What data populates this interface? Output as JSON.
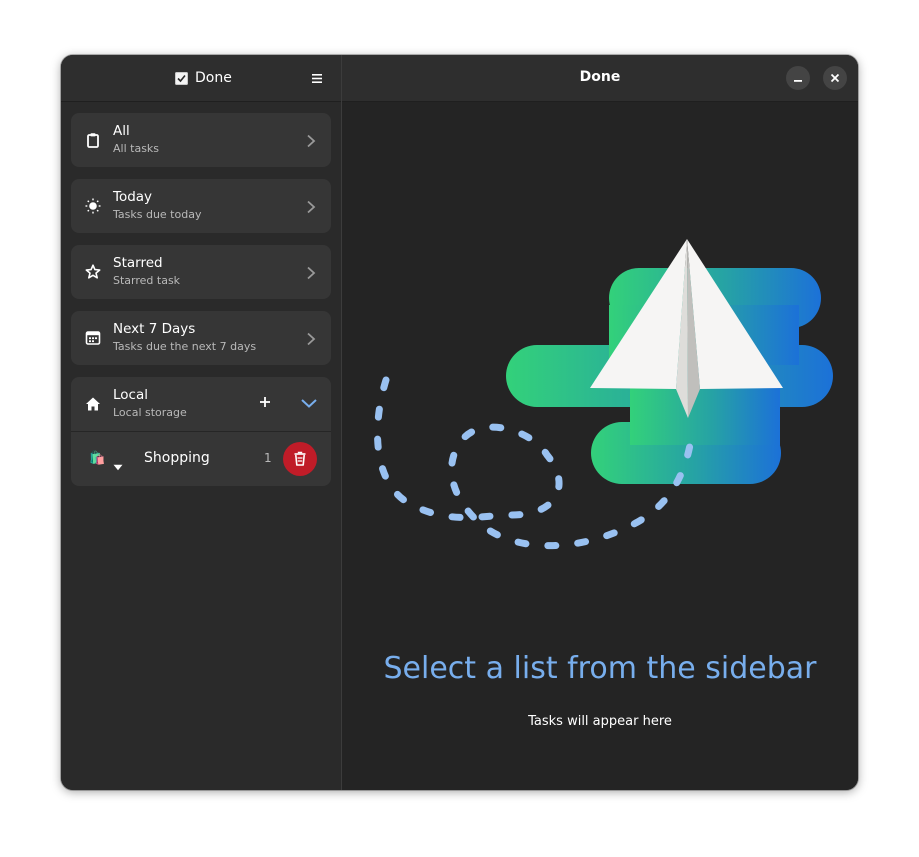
{
  "sidebar": {
    "title": "Done",
    "title_icon": "checkbox-icon",
    "menu_icon": "hamburger-menu-icon",
    "smart_lists": [
      {
        "title": "All",
        "subtitle": "All tasks",
        "icon": "clipboard-icon"
      },
      {
        "title": "Today",
        "subtitle": "Tasks due today",
        "icon": "sun-icon"
      },
      {
        "title": "Starred",
        "subtitle": "Starred task",
        "icon": "star-icon"
      },
      {
        "title": "Next 7 Days",
        "subtitle": "Tasks due the next 7 days",
        "icon": "calendar-icon"
      }
    ],
    "provider": {
      "title": "Local",
      "subtitle": "Local storage",
      "icon": "home-icon",
      "lists": [
        {
          "emoji": "🛍️",
          "label": "Shopping",
          "count": "1"
        }
      ]
    }
  },
  "main": {
    "title": "Done",
    "status_title": "Select a list from the sidebar",
    "status_description": "Tasks will appear here"
  },
  "colors": {
    "accent": "#78aeed",
    "destructive": "#c01c28",
    "window_bg": "#242424",
    "card_bg": "#363636"
  }
}
